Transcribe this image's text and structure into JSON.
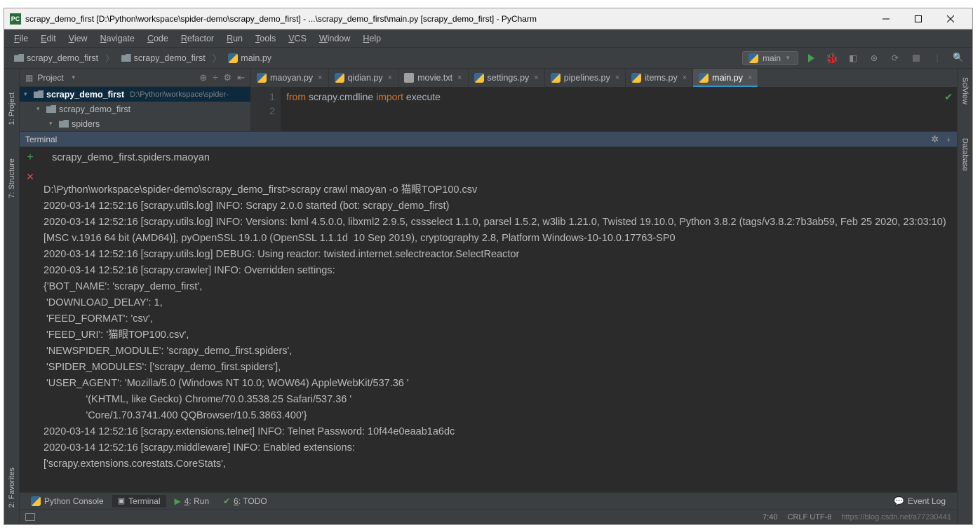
{
  "title": "scrapy_demo_first [D:\\Python\\workspace\\spider-demo\\scrapy_demo_first] - ...\\scrapy_demo_first\\main.py [scrapy_demo_first] - PyCharm",
  "menu": [
    "File",
    "Edit",
    "View",
    "Navigate",
    "Code",
    "Refactor",
    "Run",
    "Tools",
    "VCS",
    "Window",
    "Help"
  ],
  "breadcrumb": [
    {
      "type": "folder",
      "label": "scrapy_demo_first"
    },
    {
      "type": "folder",
      "label": "scrapy_demo_first"
    },
    {
      "type": "py",
      "label": "main.py"
    }
  ],
  "run_config": "main",
  "project": {
    "title": "Project",
    "tree": [
      {
        "level": 0,
        "expanded": true,
        "icon": "folder",
        "label": "scrapy_demo_first",
        "path": "D:\\Python\\workspace\\spider-",
        "selected": true
      },
      {
        "level": 1,
        "expanded": true,
        "icon": "folder",
        "label": "scrapy_demo_first"
      },
      {
        "level": 2,
        "expanded": true,
        "icon": "folder",
        "label": "spiders"
      }
    ]
  },
  "editor_tabs": [
    {
      "icon": "py",
      "label": "maoyan.py",
      "active": false
    },
    {
      "icon": "py",
      "label": "qidian.py",
      "active": false
    },
    {
      "icon": "txt",
      "label": "movie.txt",
      "active": false
    },
    {
      "icon": "py",
      "label": "settings.py",
      "active": false
    },
    {
      "icon": "py",
      "label": "pipelines.py",
      "active": false
    },
    {
      "icon": "py",
      "label": "items.py",
      "active": false
    },
    {
      "icon": "py",
      "label": "main.py",
      "active": true
    }
  ],
  "code": {
    "line1_from": "from",
    "line1_mod": "scrapy.cmdline",
    "line1_import": "import",
    "line1_name": "execute"
  },
  "terminal": {
    "title": "Terminal",
    "path_line": "   scrapy_demo_first.spiders.maoyan",
    "output": "D:\\Python\\workspace\\spider-demo\\scrapy_demo_first>scrapy crawl maoyan -o 猫眼TOP100.csv\n2020-03-14 12:52:16 [scrapy.utils.log] INFO: Scrapy 2.0.0 started (bot: scrapy_demo_first)\n2020-03-14 12:52:16 [scrapy.utils.log] INFO: Versions: lxml 4.5.0.0, libxml2 2.9.5, cssselect 1.1.0, parsel 1.5.2, w3lib 1.21.0, Twisted 19.10.0, Python 3.8.2 (tags/v3.8.2:7b3ab59, Feb 25 2020, 23:03:10) [MSC v.1916 64 bit (AMD64)], pyOpenSSL 19.1.0 (OpenSSL 1.1.1d  10 Sep 2019), cryptography 2.8, Platform Windows-10-10.0.17763-SP0\n2020-03-14 12:52:16 [scrapy.utils.log] DEBUG: Using reactor: twisted.internet.selectreactor.SelectReactor\n2020-03-14 12:52:16 [scrapy.crawler] INFO: Overridden settings:\n{'BOT_NAME': 'scrapy_demo_first',\n 'DOWNLOAD_DELAY': 1,\n 'FEED_FORMAT': 'csv',\n 'FEED_URI': '猫眼TOP100.csv',\n 'NEWSPIDER_MODULE': 'scrapy_demo_first.spiders',\n 'SPIDER_MODULES': ['scrapy_demo_first.spiders'],\n 'USER_AGENT': 'Mozilla/5.0 (Windows NT 10.0; WOW64) AppleWebKit/537.36 '\n               '(KHTML, like Gecko) Chrome/70.0.3538.25 Safari/537.36 '\n               'Core/1.70.3741.400 QQBrowser/10.5.3863.400'}\n2020-03-14 12:52:16 [scrapy.extensions.telnet] INFO: Telnet Password: 10f44e0eaab1a6dc\n2020-03-14 12:52:16 [scrapy.middleware] INFO: Enabled extensions:\n['scrapy.extensions.corestats.CoreStats',"
  },
  "bottom_tabs": [
    {
      "icon": "py",
      "label": "Python Console",
      "active": false
    },
    {
      "icon": "term",
      "label": "Terminal",
      "active": true
    },
    {
      "icon": "run",
      "label": "4: Run",
      "active": false
    },
    {
      "icon": "todo",
      "label": "6: TODO",
      "active": false
    }
  ],
  "event_log": "Event Log",
  "status": {
    "pos": "7:40",
    "encoding": "CRLF    UTF-8",
    "watermark": "https://blog.csdn.net/a77230441"
  },
  "left_gutter": [
    "1: Project",
    "7: Structure"
  ],
  "right_gutter": [
    "SciView",
    "Database"
  ],
  "left_lower": "2: Favorites"
}
